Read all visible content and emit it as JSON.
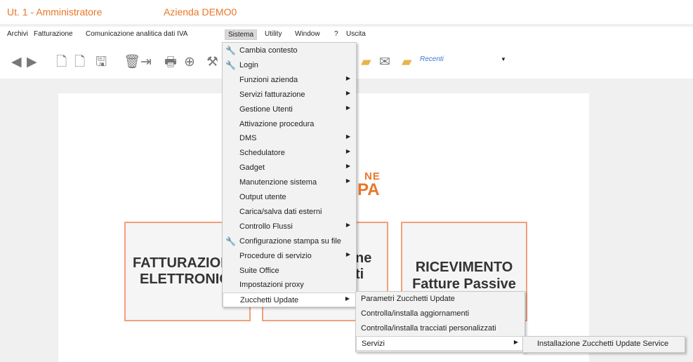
{
  "titlebar": {
    "user": "Ut. 1 - Amministratore",
    "company": "Azienda DEMO0"
  },
  "menubar": {
    "items": [
      "Archivi",
      "Fatturazione",
      "Comunicazione analitica dati IVA",
      "Sistema",
      "Utility",
      "Window",
      "?",
      "Uscita"
    ]
  },
  "toolbar": {
    "recenti": "Recenti"
  },
  "tiles": {
    "left": "FATTURAZIO⁠⁠N",
    "left_title": "FATTURAZIOI",
    "left_sub": "ELETTRONIC",
    "mid_a": "ne",
    "mid_b": "ti",
    "right_title": "RICEVIMENTO",
    "right_sub": "Fatture Passive"
  },
  "logo": {
    "l1": "NE",
    "l2": "PA"
  },
  "sistema_menu": {
    "items": [
      {
        "label": "Cambia contesto",
        "icon": "wrench-icon"
      },
      {
        "label": "Login",
        "icon": "wrench-icon"
      },
      {
        "label": "Funzioni azienda",
        "submenu": true
      },
      {
        "label": "Servizi fatturazione",
        "submenu": true
      },
      {
        "label": "Gestione Utenti",
        "submenu": true
      },
      {
        "label": "Attivazione procedura"
      },
      {
        "label": "DMS",
        "submenu": true
      },
      {
        "label": "Schedulatore",
        "submenu": true
      },
      {
        "label": "Gadget",
        "submenu": true
      },
      {
        "label": "Manutenzione sistema",
        "submenu": true
      },
      {
        "label": "Output utente"
      },
      {
        "label": "Carica/salva dati esterni"
      },
      {
        "label": "Controllo Flussi",
        "submenu": true
      },
      {
        "label": "Configurazione stampa su file",
        "icon": "wrench-icon"
      },
      {
        "label": "Procedure di servizio",
        "submenu": true
      },
      {
        "label": "Suite Office"
      },
      {
        "label": "Impostazioni proxy"
      },
      {
        "label": "Zucchetti Update",
        "submenu": true,
        "highlighted": true
      }
    ]
  },
  "update_menu": {
    "items": [
      {
        "label": "Parametri Zucchetti Update"
      },
      {
        "label": "Controlla/installa aggiornamenti"
      },
      {
        "label": "Controlla/installa tracciati personalizzati"
      },
      {
        "label": "Servizi",
        "submenu": true,
        "highlighted": true
      }
    ]
  },
  "servizi_menu": {
    "items": [
      {
        "label": "Installazione Zucchetti Update Service"
      }
    ]
  }
}
